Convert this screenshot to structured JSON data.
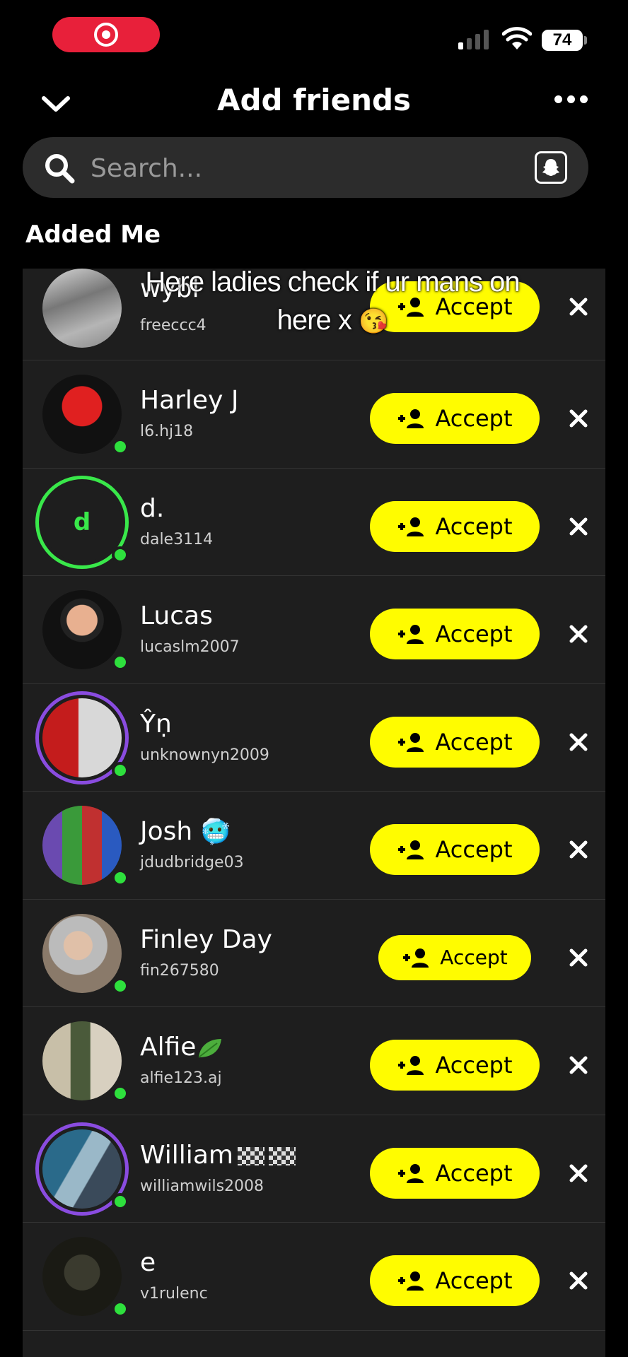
{
  "status_bar": {
    "battery": "74"
  },
  "header": {
    "title": "Add friends"
  },
  "search": {
    "placeholder": "Search..."
  },
  "section_title": "Added Me",
  "overlay_caption": "Here ladies check if ur mans on here x",
  "accept_label": "Accept",
  "rows": [
    {
      "name": "wybl",
      "username": "freeccc4"
    },
    {
      "name": "Harley J",
      "username": "l6.hj18"
    },
    {
      "name": "d.",
      "username": "dale3114",
      "avatar_initial": "d"
    },
    {
      "name": "Lucas",
      "username": "lucaslm2007"
    },
    {
      "name": "Ŷṇ",
      "username": "unknownyn2009"
    },
    {
      "name": "Josh",
      "username": "jdudbridge03"
    },
    {
      "name": "Finley Day",
      "username": "fin267580"
    },
    {
      "name": "Alfie",
      "username": "alfie123.aj"
    },
    {
      "name": "William",
      "username": "williamwils2008"
    },
    {
      "name": "e",
      "username": "v1rulenc"
    }
  ],
  "colors": {
    "accent": "#fffc00",
    "online": "#2ee03d",
    "record": "#e8203a"
  },
  "icons": [
    "record-icon",
    "signal-icon",
    "wifi-icon",
    "battery-icon",
    "chevron-down-icon",
    "more-icon",
    "search-icon",
    "snapcode-icon",
    "add-friend-icon",
    "close-icon"
  ]
}
